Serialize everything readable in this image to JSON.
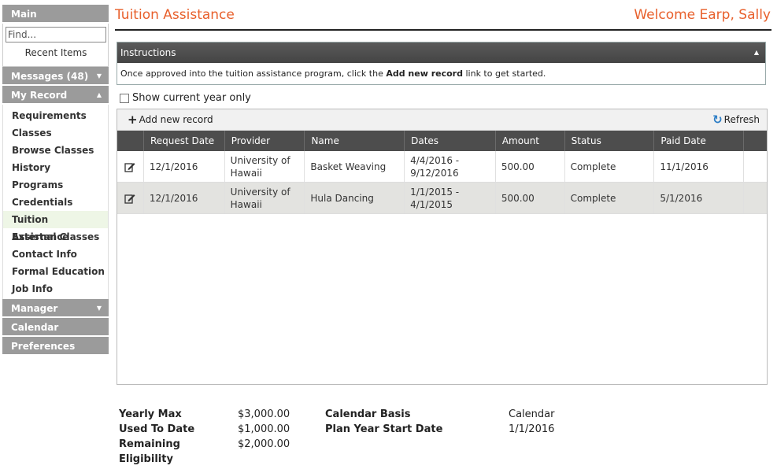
{
  "sidebar": {
    "main_label": "Main",
    "search_placeholder": "Find...",
    "recent_items": "Recent Items",
    "messages_label": "Messages (48)",
    "my_record_label": "My Record",
    "items": [
      {
        "label": "Requirements"
      },
      {
        "label": "Classes"
      },
      {
        "label": "Browse Classes"
      },
      {
        "label": "History"
      },
      {
        "label": "Programs"
      },
      {
        "label": "Credentials"
      },
      {
        "label": "Tuition Assistance"
      },
      {
        "label": "External Classes"
      },
      {
        "label": "Contact Info"
      },
      {
        "label": "Formal Education"
      },
      {
        "label": "Job Info"
      }
    ],
    "manager_label": "Manager",
    "calendar_label": "Calendar",
    "preferences_label": "Preferences"
  },
  "header": {
    "title": "Tuition Assistance",
    "welcome": "Welcome Earp, Sally"
  },
  "instructions": {
    "title": "Instructions",
    "text_before": "Once approved into the tuition assistance program, click the ",
    "text_bold": "Add new record",
    "text_after": " link to get started."
  },
  "filter": {
    "show_current_year_label": "Show current year only",
    "checked": false
  },
  "grid": {
    "add_label": "Add new record",
    "refresh_label": "Refresh",
    "columns": [
      "Request Date",
      "Provider",
      "Name",
      "Dates",
      "Amount",
      "Status",
      "Paid Date"
    ],
    "rows": [
      {
        "request_date": "12/1/2016",
        "provider_line1": "University of",
        "provider_line2": "Hawaii",
        "name": "Basket Weaving",
        "dates_line1": "4/4/2016 -",
        "dates_line2": "9/12/2016",
        "amount": "500.00",
        "status": "Complete",
        "paid_date": "11/1/2016"
      },
      {
        "request_date": "12/1/2016",
        "provider_line1": "University of",
        "provider_line2": "Hawaii",
        "name": "Hula Dancing",
        "dates_line1": "1/1/2015 -",
        "dates_line2": "4/1/2015",
        "amount": "500.00",
        "status": "Complete",
        "paid_date": "5/1/2016"
      }
    ]
  },
  "summary": {
    "yearly_max_label": "Yearly Max",
    "yearly_max_value": "$3,000.00",
    "used_to_date_label": "Used To Date",
    "used_to_date_value": "$1,000.00",
    "remaining_label_line1": "Remaining",
    "remaining_label_line2": "Eligibility",
    "remaining_value": "$2,000.00",
    "calendar_basis_label": "Calendar Basis",
    "calendar_basis_value": "Calendar",
    "plan_year_start_label": "Plan Year Start Date",
    "plan_year_start_value": "1/1/2016"
  },
  "colors": {
    "accent": "#e8602c",
    "sidebar_header": "#9b9b9b",
    "grid_header": "#4d4d4d",
    "active_item_bg": "#eef6e6"
  }
}
